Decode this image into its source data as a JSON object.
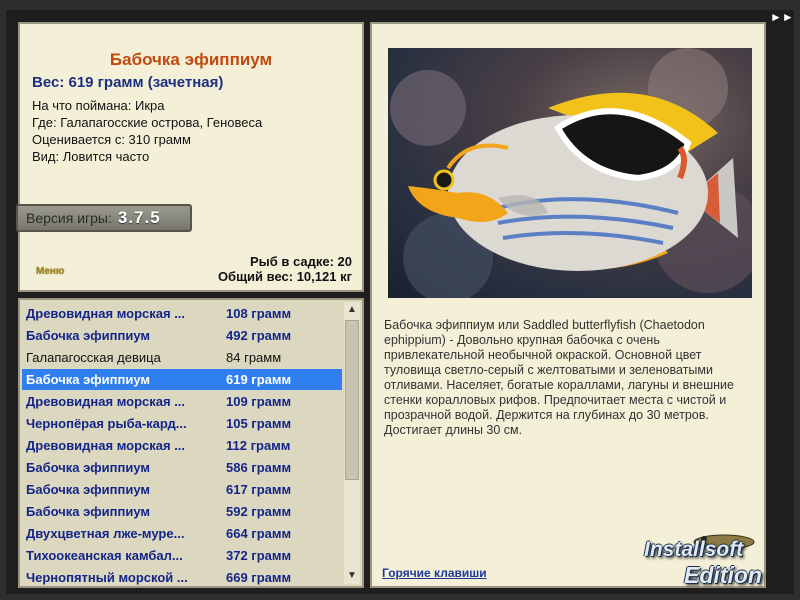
{
  "fish": {
    "title": "Бабочка эфиппиум",
    "weight_line": "Вес: 619 грамм (зачетная)",
    "caught_on": "На что поймана: Икра",
    "location": "Где: Галапагосские острова, Геновеса",
    "valued_from": "Оценивается с: 310 грамм",
    "species": "Вид: Ловится часто"
  },
  "version": {
    "label": "Версия игры:",
    "value": "3.7.5"
  },
  "menu_label": "Меню",
  "stats": {
    "fish_in_cage": "Рыб в садке: 20",
    "total_weight": "Общий вес: 10,121 кг"
  },
  "catch_list": [
    {
      "name": "Древовидная морская ...",
      "weight": "108 грамм",
      "style": "bold"
    },
    {
      "name": "Бабочка эфиппиум",
      "weight": "492 грамм",
      "style": "bold"
    },
    {
      "name": "Галапагосская девица",
      "weight": "84 грамм",
      "style": "normal"
    },
    {
      "name": "Бабочка эфиппиум",
      "weight": "619 грамм",
      "style": "selected"
    },
    {
      "name": "Древовидная морская ...",
      "weight": "109 грамм",
      "style": "bold"
    },
    {
      "name": "Чернопёрая рыба-кард...",
      "weight": "105 грамм",
      "style": "bold"
    },
    {
      "name": "Древовидная морская ...",
      "weight": "112 грамм",
      "style": "bold"
    },
    {
      "name": "Бабочка эфиппиум",
      "weight": "586 грамм",
      "style": "bold"
    },
    {
      "name": "Бабочка эфиппиум",
      "weight": "617 грамм",
      "style": "bold"
    },
    {
      "name": "Бабочка эфиппиум",
      "weight": "592 грамм",
      "style": "bold"
    },
    {
      "name": "Двухцветная лже-муре...",
      "weight": "664 грамм",
      "style": "bold"
    },
    {
      "name": "Тихоокеанская камбал...",
      "weight": "372 грамм",
      "style": "bold"
    },
    {
      "name": "Чернопятный морской ...",
      "weight": "669 грамм",
      "style": "bold"
    }
  ],
  "description": "Бабочка эфиппиум или Saddled butterflyfish (Chaetodon ephippium) - Довольно крупная бабочка с очень привлекательной необычной окраской. Основной цвет туловища светло-серый с желтоватыми и зеленоватыми отливами. Населяет, богатые кораллами, лагуны и внешние стенки коралловых рифов. Предпочитает места с чистой и прозрачной водой. Держится на глубинах до 30 метров. Достигает длины 30 см.",
  "hotkeys_label": "Горячие клавиши",
  "watermark": {
    "line1": "Installsoft",
    "line2": "Edition"
  },
  "colors": {
    "panel_bg": "#f4f0d8",
    "list_bg": "#dcd8c0",
    "title_color": "#c04a10",
    "list_bold_color": "#14258a",
    "selection": "#2f7ff0"
  }
}
